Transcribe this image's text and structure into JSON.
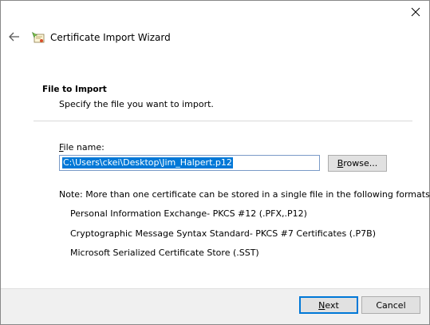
{
  "window": {
    "title": "Certificate Import Wizard",
    "close_icon": "close-icon",
    "back_icon": "back-arrow-icon",
    "wizard_icon": "certificate-wizard-icon"
  },
  "page": {
    "heading": "File to Import",
    "subheading": "Specify the file you want to import."
  },
  "file": {
    "label_first": "F",
    "label_rest": "ile name:",
    "value": "C:\\Users\\ckei\\Desktop\\Jim_Halpert.p12"
  },
  "browse": {
    "label_first": "B",
    "label_rest": "rowse..."
  },
  "note": {
    "text": "Note:  More than one certificate can be stored in a single file in the following formats:",
    "formats": [
      "Personal Information Exchange- PKCS #12 (.PFX,.P12)",
      "Cryptographic Message Syntax Standard- PKCS #7 Certificates (.P7B)",
      "Microsoft Serialized Certificate Store (.SST)"
    ]
  },
  "footer": {
    "next_first": "N",
    "next_rest": "ext",
    "cancel_label": "Cancel"
  },
  "colors": {
    "accent": "#0078d7",
    "footer_bg": "#f0f0f0",
    "button_bg": "#e1e1e1"
  }
}
